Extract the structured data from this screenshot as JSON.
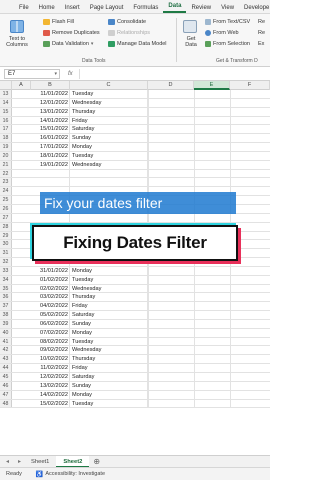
{
  "ribbon_tabs": [
    "File",
    "Home",
    "Insert",
    "Page Layout",
    "Formulas",
    "Data",
    "Review",
    "View",
    "Develope"
  ],
  "active_tab": "Data",
  "ribbon": {
    "text_to_columns": "Text to Columns",
    "flash_fill": "Flash Fill",
    "remove_duplicates": "Remove Duplicates",
    "data_validation": "Data Validation",
    "consolidate": "Consolidate",
    "relationships": "Relationships",
    "manage_data_model": "Manage Data Model",
    "group_data_tools": "Data Tools",
    "get_data": "Get Data",
    "from_text_csv": "From Text/CSV",
    "from_web": "From Web",
    "from_selection": "From Selection",
    "group_get_transform": "Get & Transform D",
    "col_right": [
      "Re",
      "Re",
      "Ex"
    ]
  },
  "formula_bar": {
    "name_box": "E7",
    "fx": "fx"
  },
  "columns": [
    "A",
    "B",
    "C",
    "D",
    "E",
    "F"
  ],
  "selected_column": "E",
  "rows": [
    {
      "n": "13",
      "date": "11/01/2022",
      "day": "Tuesday"
    },
    {
      "n": "14",
      "date": "12/01/2022",
      "day": "Wednesday"
    },
    {
      "n": "15",
      "date": "13/01/2022",
      "day": "Thursday"
    },
    {
      "n": "16",
      "date": "14/01/2022",
      "day": "Friday"
    },
    {
      "n": "17",
      "date": "15/01/2022",
      "day": "Saturday"
    },
    {
      "n": "18",
      "date": "16/01/2022",
      "day": "Sunday"
    },
    {
      "n": "19",
      "date": "17/01/2022",
      "day": "Monday"
    },
    {
      "n": "20",
      "date": "18/01/2022",
      "day": "Tuesday"
    },
    {
      "n": "21",
      "date": "19/01/2022",
      "day": "Wednesday"
    },
    {
      "n": "22",
      "date": "",
      "day": ""
    },
    {
      "n": "23",
      "date": "",
      "day": ""
    },
    {
      "n": "24",
      "date": "",
      "day": ""
    },
    {
      "n": "25",
      "date": "",
      "day": ""
    },
    {
      "n": "26",
      "date": "",
      "day": ""
    },
    {
      "n": "27",
      "date": "",
      "day": ""
    },
    {
      "n": "28",
      "date": "",
      "day": ""
    },
    {
      "n": "29",
      "date": "",
      "day": ""
    },
    {
      "n": "30",
      "date": "28/01/2022",
      "day": "Friday"
    },
    {
      "n": "31",
      "date": "29/01/2022",
      "day": "Saturday"
    },
    {
      "n": "32",
      "date": "30/01/2022",
      "day": "Sunday"
    },
    {
      "n": "33",
      "date": "31/01/2022",
      "day": "Monday"
    },
    {
      "n": "34",
      "date": "01/02/2022",
      "day": "Tuesday"
    },
    {
      "n": "35",
      "date": "02/02/2022",
      "day": "Wednesday"
    },
    {
      "n": "36",
      "date": "03/02/2022",
      "day": "Thursday"
    },
    {
      "n": "37",
      "date": "04/02/2022",
      "day": "Friday"
    },
    {
      "n": "38",
      "date": "05/02/2022",
      "day": "Saturday"
    },
    {
      "n": "39",
      "date": "06/02/2022",
      "day": "Sunday"
    },
    {
      "n": "40",
      "date": "07/02/2022",
      "day": "Monday"
    },
    {
      "n": "41",
      "date": "08/02/2022",
      "day": "Tuesday"
    },
    {
      "n": "42",
      "date": "09/02/2022",
      "day": "Wednesday"
    },
    {
      "n": "43",
      "date": "10/02/2022",
      "day": "Thursday"
    },
    {
      "n": "44",
      "date": "11/02/2022",
      "day": "Friday"
    },
    {
      "n": "45",
      "date": "12/02/2022",
      "day": "Saturday"
    },
    {
      "n": "46",
      "date": "13/02/2022",
      "day": "Sunday"
    },
    {
      "n": "47",
      "date": "14/02/2022",
      "day": "Monday"
    },
    {
      "n": "48",
      "date": "15/02/2022",
      "day": "Tuesday"
    }
  ],
  "overlay": {
    "subtitle": "Fix your dates filter",
    "title": "Fixing Dates Filter"
  },
  "sheets": [
    "Sheet1",
    "Sheet2"
  ],
  "active_sheet": "Sheet2",
  "status": {
    "ready": "Ready",
    "accessibility": "Accessibility: Investigate"
  },
  "colors": {
    "excel_green": "#1e7a45",
    "banner_blue": "#1e7ad1",
    "accent_pink": "#e8305a",
    "accent_cyan": "#2fd4e0"
  }
}
